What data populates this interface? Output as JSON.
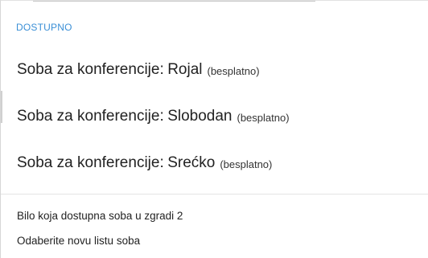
{
  "section": {
    "header": "DOSTUPNO"
  },
  "rooms": [
    {
      "prefix": "Soba za konferencije:",
      "room": "Rojal",
      "price": "(besplatno)"
    },
    {
      "prefix": "Soba za konferencije:",
      "room": "Slobodan",
      "price": "(besplatno)"
    },
    {
      "prefix": "Soba za konferencije:",
      "room": "Srećko",
      "price": "(besplatno)"
    }
  ],
  "links": {
    "any_room": "Bilo koja dostupna soba u zgradi 2",
    "choose_list": "Odaberite novu listu soba"
  },
  "colors": {
    "header": "#3a8fd6",
    "text": "#222222",
    "divider": "#e4e4e4"
  }
}
